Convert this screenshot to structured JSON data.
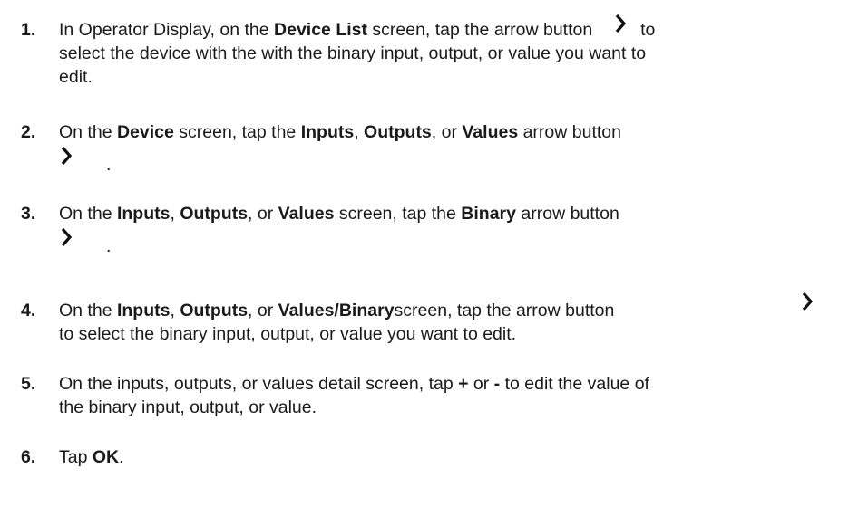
{
  "steps": [
    {
      "number": "1.",
      "line1_pre": "In Operator Display, on the ",
      "line1_bold": "Device List",
      "line1_post": " screen, tap the arrow button",
      "line1_after_icon": "to",
      "line2": "select the device with the with the binary input, output, or value you want to",
      "line3": "edit."
    },
    {
      "number": "2.",
      "pre": "On the ",
      "b1": "Device",
      "mid1": " screen, tap the ",
      "b2": "Inputs",
      "sep1": ", ",
      "b3": "Outputs",
      "sep2": ", or ",
      "b4": "Values",
      "post": " arrow button",
      "after_icon": "."
    },
    {
      "number": "3.",
      "pre": "On the ",
      "b1": "Inputs",
      "sep1": ", ",
      "b2": "Outputs",
      "sep2": ", or ",
      "b3": "Values",
      "mid": " screen, tap the ",
      "b4": "Binary",
      "post": " arrow button",
      "after_icon": "."
    },
    {
      "number": "4.",
      "pre": "On the ",
      "b1": "Inputs",
      "sep1": ", ",
      "b2": "Outputs",
      "sep2": ", or ",
      "b3": "Values/Binary",
      "post": "screen, tap the arrow button",
      "line2": "to select the binary input, output, or value you want to edit."
    },
    {
      "number": "5.",
      "pre": "On the inputs, outputs, or values detail screen, tap ",
      "b1": "+",
      "mid": " or ",
      "b2": "-",
      "post": " to edit the value of",
      "line2": "the binary input, output, or value."
    },
    {
      "number": "6.",
      "pre": "Tap ",
      "b1": "OK",
      "post": "."
    }
  ],
  "icons": {
    "arrow": "chevron-right-icon"
  }
}
